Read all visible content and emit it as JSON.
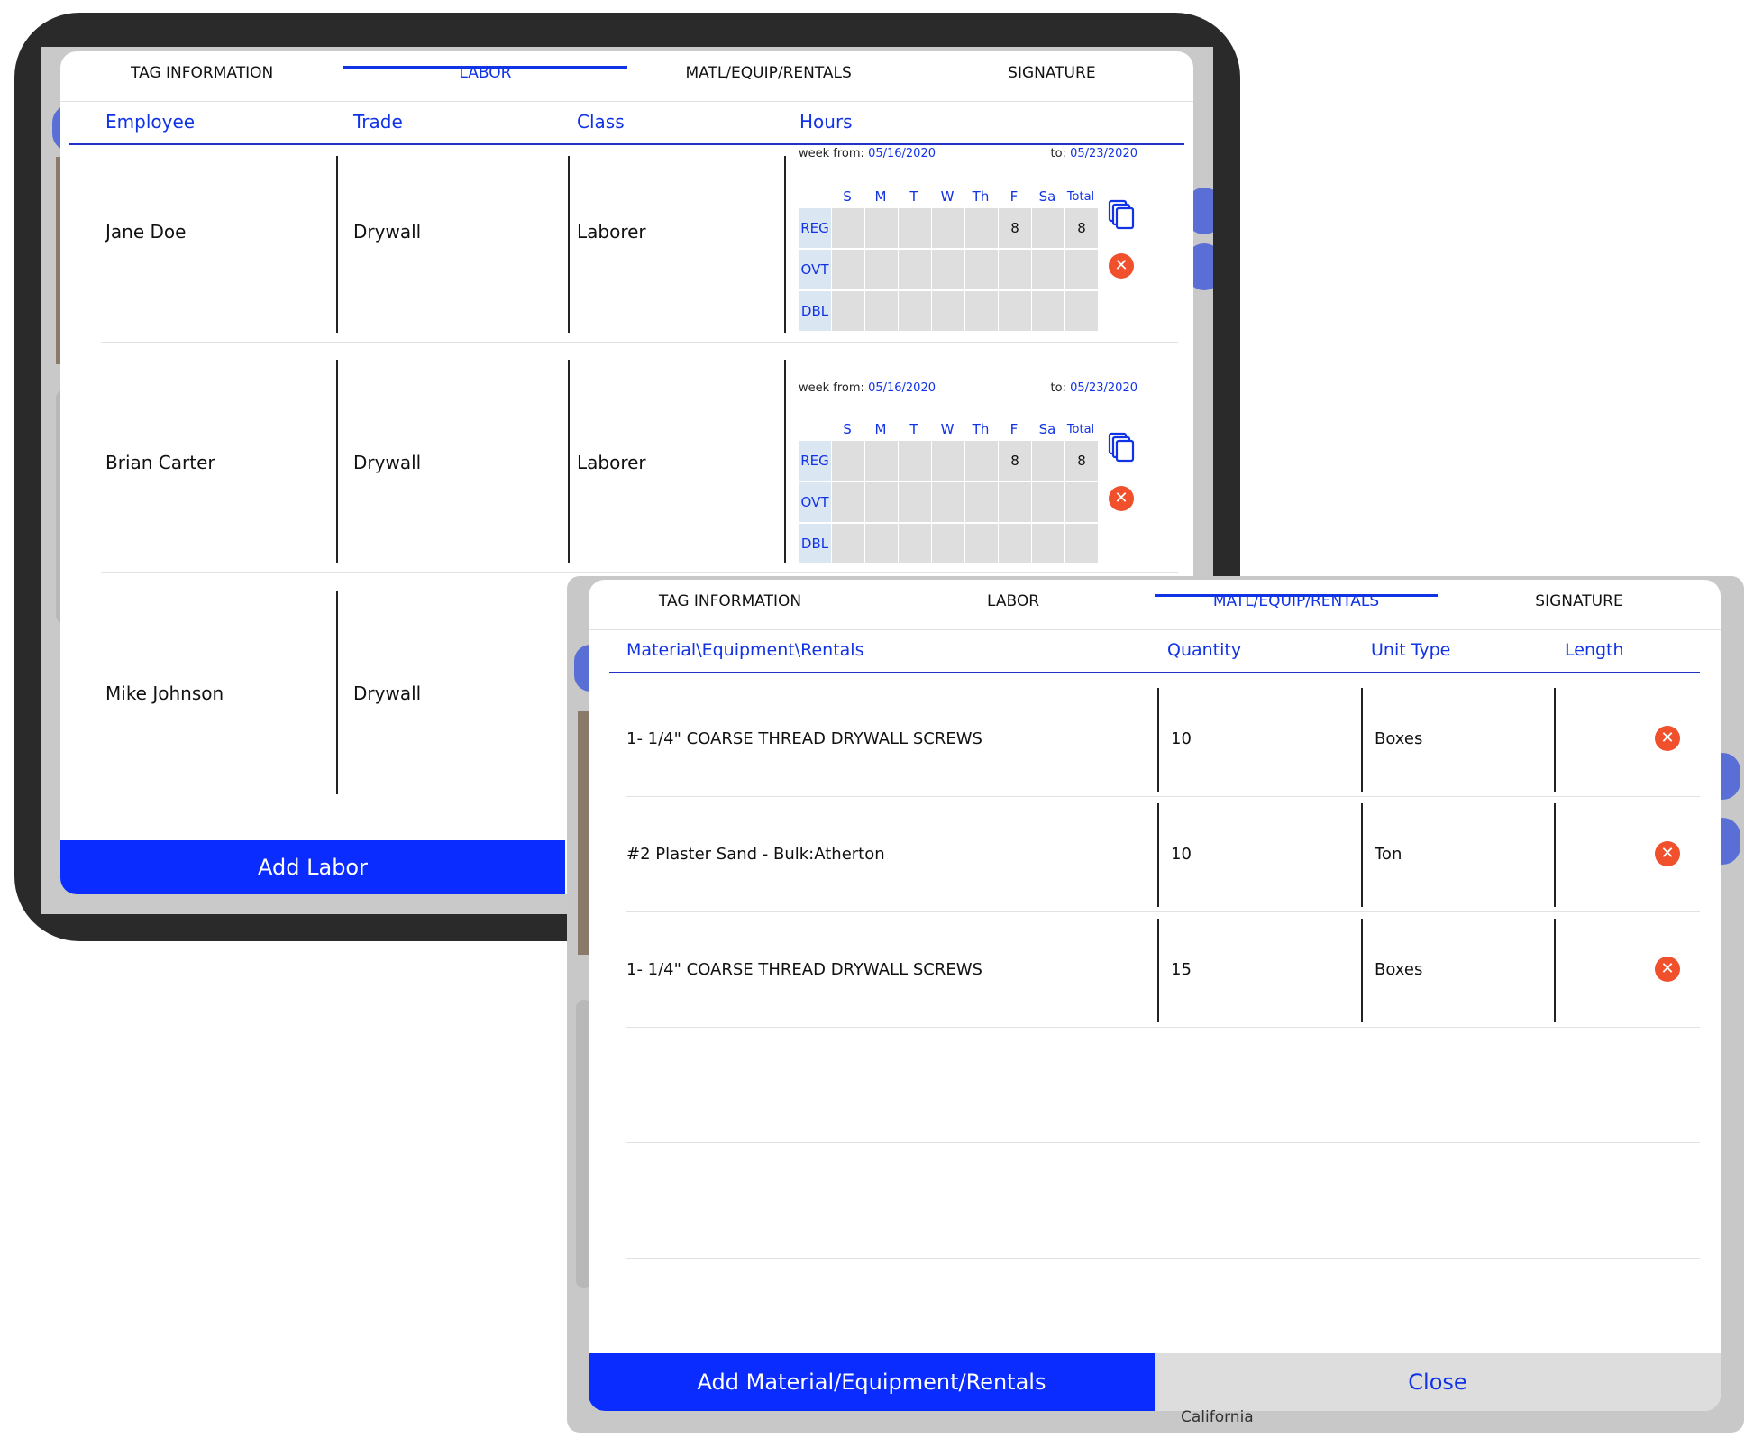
{
  "labor_dialog": {
    "tabs": [
      {
        "label": "TAG INFORMATION",
        "active": false
      },
      {
        "label": "LABOR",
        "active": true
      },
      {
        "label": "MATL/EQUIP/RENTALS",
        "active": false
      },
      {
        "label": "SIGNATURE",
        "active": false
      }
    ],
    "columns": {
      "employee": "Employee",
      "trade": "Trade",
      "class": "Class",
      "hours": "Hours"
    },
    "day_headers": [
      "S",
      "M",
      "T",
      "W",
      "Th",
      "F",
      "Sa",
      "Total"
    ],
    "row_labels": [
      "REG",
      "OVT",
      "DBL"
    ],
    "week_from_label": "week from:",
    "to_label": "to:",
    "rows": [
      {
        "employee": "Jane Doe",
        "trade": "Drywall",
        "class": "Laborer",
        "week_from": "05/16/2020",
        "week_to": "05/23/2020",
        "reg": [
          "",
          "",
          "",
          "",
          "",
          "8",
          "",
          "8"
        ],
        "ovt": [
          "",
          "",
          "",
          "",
          "",
          "",
          "",
          ""
        ],
        "dbl": [
          "",
          "",
          "",
          "",
          "",
          "",
          "",
          ""
        ]
      },
      {
        "employee": "Brian Carter",
        "trade": "Drywall",
        "class": "Laborer",
        "week_from": "05/16/2020",
        "week_to": "05/23/2020",
        "reg": [
          "",
          "",
          "",
          "",
          "",
          "8",
          "",
          "8"
        ],
        "ovt": [
          "",
          "",
          "",
          "",
          "",
          "",
          "",
          ""
        ],
        "dbl": [
          "",
          "",
          "",
          "",
          "",
          "",
          "",
          ""
        ]
      },
      {
        "employee": "Mike Johnson",
        "trade": "Drywall"
      }
    ],
    "add_button": "Add Labor"
  },
  "material_dialog": {
    "tabs": [
      {
        "label": "TAG INFORMATION",
        "active": false
      },
      {
        "label": "LABOR",
        "active": false
      },
      {
        "label": "MATL/EQUIP/RENTALS",
        "active": true
      },
      {
        "label": "SIGNATURE",
        "active": false
      }
    ],
    "columns": {
      "material": "Material\\Equipment\\Rentals",
      "quantity": "Quantity",
      "unit_type": "Unit Type",
      "length": "Length"
    },
    "rows": [
      {
        "material": "1- 1/4\" COARSE THREAD DRYWALL SCREWS",
        "quantity": "10",
        "unit_type": "Boxes",
        "length": ""
      },
      {
        "material": "#2 Plaster Sand - Bulk:Atherton",
        "quantity": "10",
        "unit_type": "Ton",
        "length": ""
      },
      {
        "material": "1- 1/4\" COARSE THREAD DRYWALL SCREWS",
        "quantity": "15",
        "unit_type": "Boxes",
        "length": ""
      }
    ],
    "add_button": "Add Material/Equipment/Rentals",
    "close_button": "Close"
  },
  "background": {
    "state_field": "California"
  },
  "colors": {
    "accent": "#1133e6",
    "primary_button": "#0a2cff",
    "delete": "#f0502b",
    "hour_cell": "#dedede",
    "row_label_bg": "#dbe6f3"
  },
  "icons": {
    "copy": "copy-icon",
    "delete": "delete-icon"
  }
}
